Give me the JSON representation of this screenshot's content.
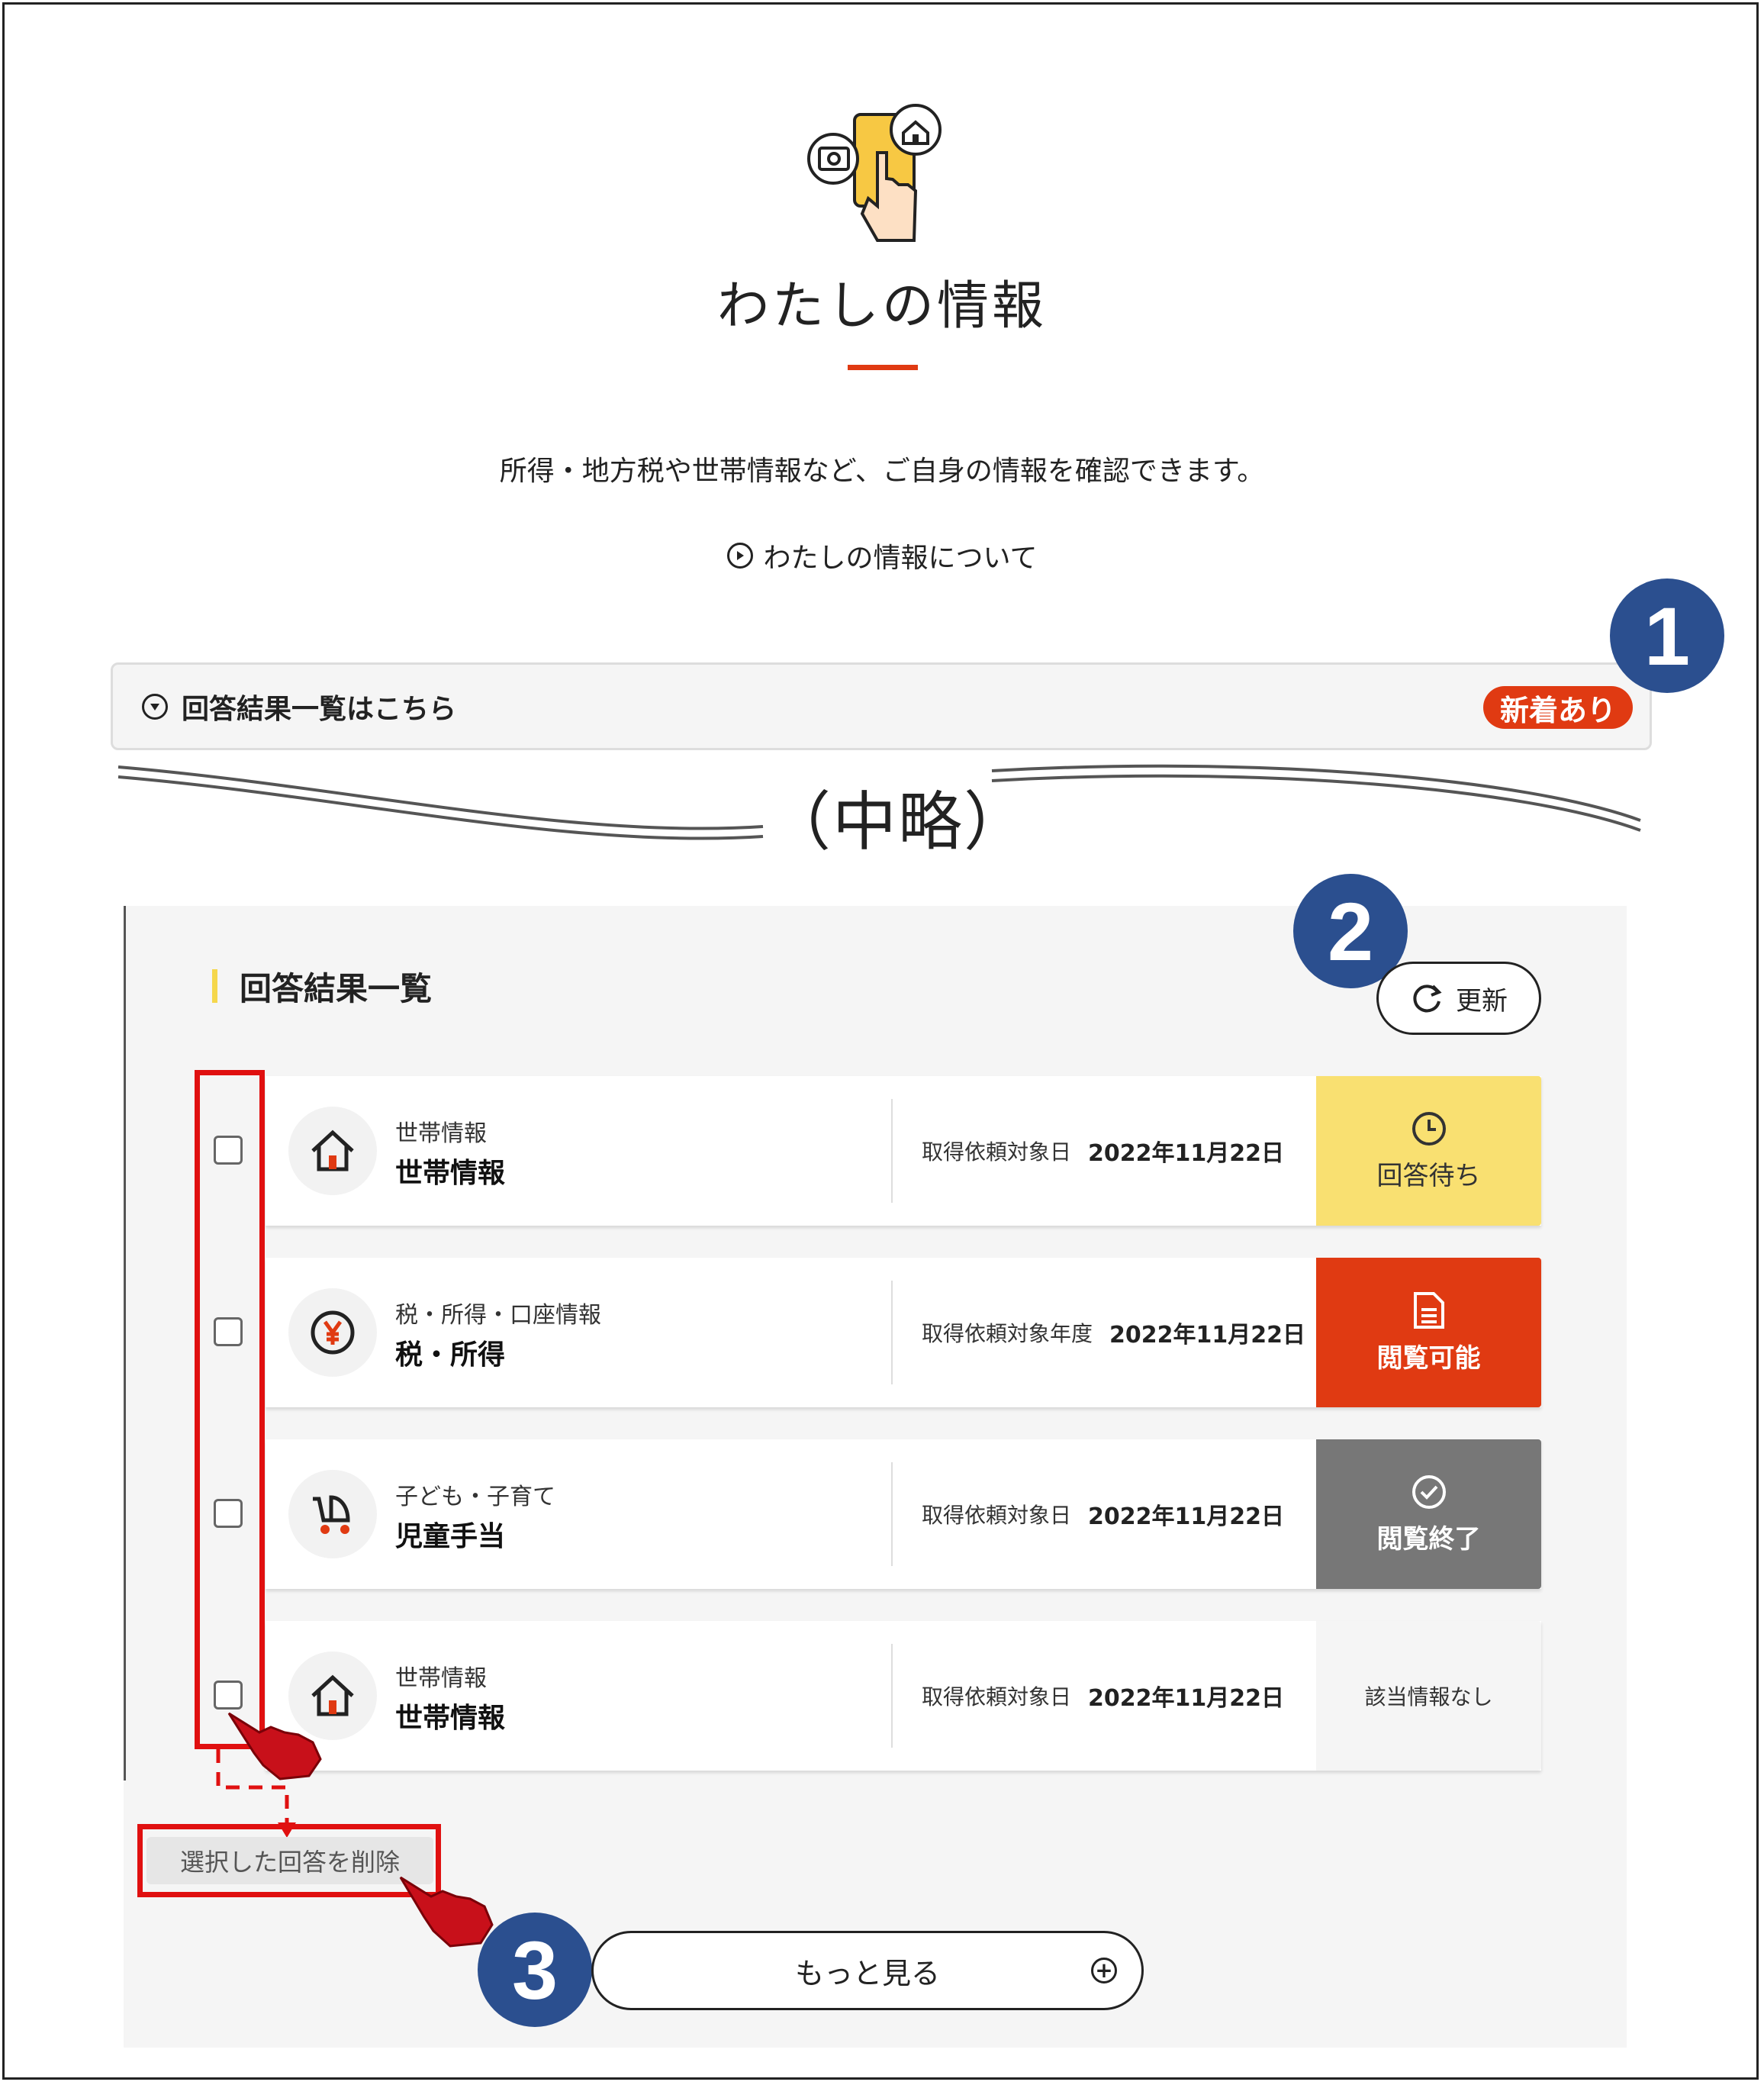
{
  "header": {
    "title": "わたしの情報",
    "lead": "所得・地方税や世帯情報など、ご自身の情報を確認できます。",
    "about_link": "わたしの情報について"
  },
  "accordion": {
    "label": "回答結果一覧はこちら",
    "badge": "新着あり"
  },
  "omission": "（中略）",
  "callouts": [
    "1",
    "2",
    "3"
  ],
  "results": {
    "title": "回答結果一覧",
    "refresh_label": "更新",
    "rows": [
      {
        "icon": "house-icon",
        "category": "世帯情報",
        "name": "世帯情報",
        "date_label": "取得依頼対象日",
        "date": "2022年11月22日",
        "status": "回答待ち",
        "status_icon": "clock-icon"
      },
      {
        "icon": "yen-icon",
        "category": "税・所得・口座情報",
        "name": "税・所得",
        "date_label": "取得依頼対象年度",
        "date": "2022年11月22日",
        "status": "閲覧可能",
        "status_icon": "document-icon"
      },
      {
        "icon": "stroller-icon",
        "category": "子ども・子育て",
        "name": "児童手当",
        "date_label": "取得依頼対象日",
        "date": "2022年11月22日",
        "status": "閲覧終了",
        "status_icon": "check-circle-icon"
      },
      {
        "icon": "house-icon",
        "category": "世帯情報",
        "name": "世帯情報",
        "date_label": "取得依頼対象日",
        "date": "2022年11月22日",
        "status": "該当情報なし",
        "status_icon": ""
      }
    ],
    "delete_label": "選択した回答を削除",
    "more_label": "もっと見る"
  },
  "colors": {
    "accent_red": "#e03a12",
    "wait_yellow": "#f9e071",
    "done_gray": "#777777",
    "callout_blue": "#2b4f8f",
    "highlight_red": "#e01010"
  }
}
